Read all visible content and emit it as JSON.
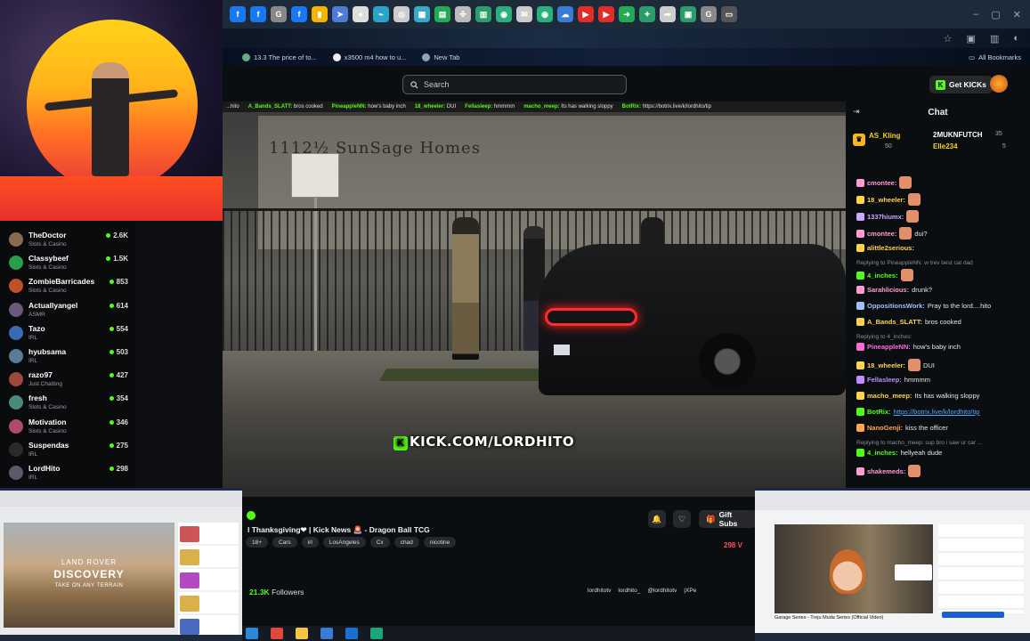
{
  "browser": {
    "tab_icons": [
      {
        "icon": "facebook-icon",
        "color": "#1877f2",
        "glyph": "f"
      },
      {
        "icon": "facebook-icon",
        "color": "#1877f2",
        "glyph": "f"
      },
      {
        "icon": "google-icon",
        "color": "#888888",
        "glyph": "G"
      },
      {
        "icon": "facebook-icon",
        "color": "#1877f2",
        "glyph": "f"
      },
      {
        "icon": "docs-icon",
        "color": "#f4b400",
        "glyph": "▮"
      },
      {
        "icon": "arrow-icon",
        "color": "#4e7bd8",
        "glyph": "➤"
      },
      {
        "icon": "circle-icon",
        "color": "#dddddd",
        "glyph": "●"
      },
      {
        "icon": "link-icon",
        "color": "#2aa3c8",
        "glyph": "⌁"
      },
      {
        "icon": "compass-icon",
        "color": "#cccccc",
        "glyph": "◎"
      },
      {
        "icon": "grid-icon",
        "color": "#3aa8c8",
        "glyph": "▦"
      },
      {
        "icon": "sheet-icon",
        "color": "#22aa55",
        "glyph": "▤"
      },
      {
        "icon": "apps-icon",
        "color": "#bbbbbb",
        "glyph": "✣"
      },
      {
        "icon": "table-icon",
        "color": "#2a9d6a",
        "glyph": "▥"
      },
      {
        "icon": "globe-icon",
        "color": "#2ab07a",
        "glyph": "◉"
      },
      {
        "icon": "mail-icon",
        "color": "#cccccc",
        "glyph": "✉"
      },
      {
        "icon": "globe-icon",
        "color": "#2ab07a",
        "glyph": "◉"
      },
      {
        "icon": "cloud-icon",
        "color": "#3a7bd5",
        "glyph": "☁"
      },
      {
        "icon": "youtube-icon",
        "color": "#e52d27",
        "glyph": "▶"
      },
      {
        "icon": "youtube-icon",
        "color": "#e52d27",
        "glyph": "▶"
      },
      {
        "icon": "arrow-icon",
        "color": "#22aa55",
        "glyph": "➜"
      },
      {
        "icon": "puzzle-icon",
        "color": "#2a9d6a",
        "glyph": "✦"
      },
      {
        "icon": "share-icon",
        "color": "#cccccc",
        "glyph": "➦"
      },
      {
        "icon": "bookmark-icon",
        "color": "#2a9d6a",
        "glyph": "▣"
      },
      {
        "icon": "google-icon",
        "color": "#888888",
        "glyph": "G"
      },
      {
        "icon": "video-icon",
        "color": "#555555",
        "glyph": "▭"
      }
    ],
    "bookmarks": [
      {
        "label": "13.3 The price of to...",
        "icon": "page-icon"
      },
      {
        "label": "x3500 m4 how to u...",
        "icon": "google-icon"
      },
      {
        "label": "New Tab",
        "icon": "newtab-icon"
      }
    ],
    "all_bookmarks": "All Bookmarks"
  },
  "kick": {
    "search_placeholder": "Search",
    "get_kicks": "Get KICKs",
    "ticker": [
      {
        "user": "",
        "text": "...hito"
      },
      {
        "user": "A_Bands_SLATT:",
        "text": "bros cooked"
      },
      {
        "user": "PineappleNN:",
        "text": "how's baby inch"
      },
      {
        "user": "18_wheeler:",
        "text": "DUI"
      },
      {
        "user": "Fellasleep:",
        "text": "hmmmm"
      },
      {
        "user": "macho_meep:",
        "text": "Its has walking sloppy"
      },
      {
        "user": "BotRix:",
        "text": "https://botrix.live/k/lordhito/tip"
      }
    ],
    "video": {
      "building_sign": "1112½ SunSage Homes",
      "watermark": "KICK.COM/LORDHITO"
    },
    "stream": {
      "title": "l Thanksgiving❤ | Kick News 🚨 - Dragon Ball TCG",
      "tags": [
        "18+",
        "Cars",
        "irl",
        "LosAngeles",
        "Cx",
        "chad",
        "nicotine"
      ],
      "followers_count": "21.3K",
      "followers_label": "Followers",
      "gift_subs": "Gift Subs",
      "viewers": "298 V",
      "socials": [
        "lordhitotv",
        "lordhito_",
        "@lordhitotv",
        "|XPe"
      ]
    },
    "chat": {
      "title": "Chat",
      "pinned": {
        "first": {
          "name": "AS_Kling",
          "amount": "50"
        },
        "second": {
          "name": "2MUKNFUTCH",
          "amount": "35"
        },
        "third": {
          "name": "Elle234",
          "amount": "5"
        }
      },
      "messages": [
        {
          "user": "cmontee:",
          "color": "#ff9bd2",
          "text": "",
          "emote": true,
          "reply": ""
        },
        {
          "user": "18_wheeler:",
          "color": "#ffd34d",
          "text": "",
          "emote": true,
          "reply": ""
        },
        {
          "user": "1337hiumx:",
          "color": "#c9a8ff",
          "text": "",
          "emote": true,
          "reply": ""
        },
        {
          "user": "cmontee:",
          "color": "#ff9bd2",
          "text": "dui?",
          "emote": true,
          "reply": ""
        },
        {
          "user": "alittle2serious:",
          "color": "#ffd34d",
          "text": "",
          "emote": false,
          "reply": ""
        },
        {
          "user": "4_inches:",
          "color": "#53fc18",
          "text": "",
          "emote": true,
          "reply": "Replying to PineappleNN: w trev best cat dad"
        },
        {
          "user": "Sarahlicious:",
          "color": "#ff9bd2",
          "text": "drunk?",
          "emote": false,
          "reply": ""
        },
        {
          "user": "OppositionsWork:",
          "color": "#9ec2ff",
          "text": "Pray to the lord....hito",
          "emote": false,
          "reply": ""
        },
        {
          "user": "A_Bands_SLATT:",
          "color": "#ffd34d",
          "text": "bros cooked",
          "emote": false,
          "reply": ""
        },
        {
          "user": "PineappleNN:",
          "color": "#ff6bd6",
          "text": "how's baby inch",
          "emote": false,
          "reply": "Replying to 4_inches:"
        },
        {
          "user": "18_wheeler:",
          "color": "#ffd34d",
          "text": "DUI",
          "emote": true,
          "reply": ""
        },
        {
          "user": "Fellasleep:",
          "color": "#c08cff",
          "text": "hmmmm",
          "emote": false,
          "reply": ""
        },
        {
          "user": "macho_meep:",
          "color": "#ffd34d",
          "text": "Its has walking sloppy",
          "emote": false,
          "reply": ""
        },
        {
          "user": "BotRix:",
          "color": "#53fc18",
          "text": "https://botrix.live/k/lordhito/tip",
          "emote": false,
          "reply": ""
        },
        {
          "user": "NanoGenji:",
          "color": "#ffa64d",
          "text": "kiss the officer",
          "emote": false,
          "reply": ""
        },
        {
          "user": "4_inches:",
          "color": "#53fc18",
          "text": "hellyeah dude",
          "emote": false,
          "reply": "Replying to macho_meep: sup bro i saw ur car ..."
        },
        {
          "user": "shakemeds:",
          "color": "#ff9bd2",
          "text": "",
          "emote": true,
          "reply": ""
        }
      ]
    }
  },
  "leaderboard": [
    {
      "name": "TheDoctor",
      "category": "Slots & Casino",
      "count": "2.6K",
      "color": "#8a6a4e"
    },
    {
      "name": "Classybeef",
      "category": "Slots & Casino",
      "count": "1.5K",
      "color": "#2a9d4a"
    },
    {
      "name": "ZombieBarricades",
      "category": "Slots & Casino",
      "count": "853",
      "color": "#c0502a"
    },
    {
      "name": "Actuallyangel",
      "category": "ASMR",
      "count": "614",
      "color": "#6a5a7a"
    },
    {
      "name": "Tazo",
      "category": "IRL",
      "count": "554",
      "color": "#3a6ab0"
    },
    {
      "name": "hyubsama",
      "category": "IRL",
      "count": "503",
      "color": "#5a7a9a"
    },
    {
      "name": "razo97",
      "category": "Just Chatting",
      "count": "427",
      "color": "#9a4a3a"
    },
    {
      "name": "fresh",
      "category": "Slots & Casino",
      "count": "354",
      "color": "#4a8a7a"
    },
    {
      "name": "Motivation",
      "category": "Slots & Casino",
      "count": "346",
      "color": "#b04a6a"
    },
    {
      "name": "Suspendas",
      "category": "IRL",
      "count": "275",
      "color": "#2a2a2a"
    },
    {
      "name": "LordHito",
      "category": "IRL",
      "count": "298",
      "color": "#5a5a6a"
    }
  ],
  "left_overlay": {
    "ad_line1": "LAND ROVER",
    "ad_line2": "DISCOVERY",
    "ad_line3": "TAKE ON ANY TERRAIN"
  },
  "right_overlay": {
    "caption": "Garage Series - Treju Muda Series (Official Video)"
  },
  "taskbar": [
    {
      "icon": "edge-icon",
      "color": "#2a8ad8"
    },
    {
      "icon": "chrome-icon",
      "color": "#e2473b"
    },
    {
      "icon": "folder-icon",
      "color": "#f5c542"
    },
    {
      "icon": "calendar-icon",
      "color": "#3a7bd5"
    },
    {
      "icon": "outlook-icon",
      "color": "#1a6fd0"
    },
    {
      "icon": "app-icon",
      "color": "#1aa57a"
    }
  ]
}
